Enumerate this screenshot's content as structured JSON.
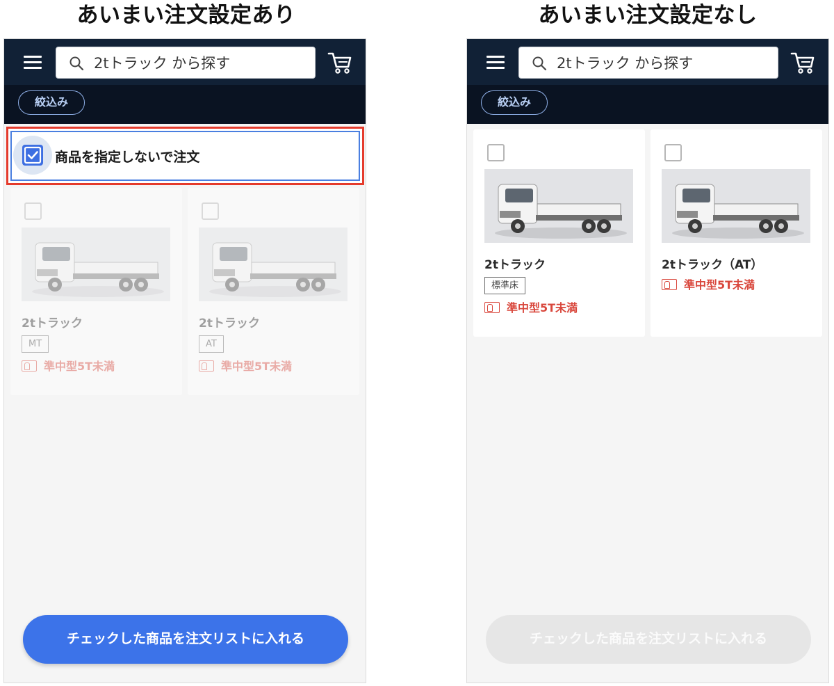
{
  "titles": {
    "left": "あいまい注文設定あり",
    "right": "あいまい注文設定なし"
  },
  "left_screen": {
    "search_text": "2tトラック から探す",
    "filter_label": "絞込み",
    "ambiguous_label": "商品を指定しないで注文",
    "ambiguous_checked": true,
    "products": [
      {
        "name": "2tトラック",
        "tag": "MT",
        "license": "準中型5T未満",
        "checked": false
      },
      {
        "name": "2tトラック",
        "tag": "AT",
        "license": "準中型5T未満",
        "checked": false
      }
    ],
    "cta_label": "チェックした商品を注文リストに入れる",
    "cta_enabled": true
  },
  "right_screen": {
    "search_text": "2tトラック から探す",
    "filter_label": "絞込み",
    "products": [
      {
        "name": "2tトラック",
        "tag": "標準床",
        "license": "準中型5T未満",
        "checked": false
      },
      {
        "name": "2tトラック（AT）",
        "license": "準中型5T未満",
        "checked": false
      }
    ],
    "cta_label": "チェックした商品を注文リストに入れる",
    "cta_enabled": false
  },
  "icons": {
    "menu": "hamburger-icon",
    "search": "search-icon",
    "cart": "cart-icon",
    "checkbox": "checkbox-icon",
    "license": "license-card-icon"
  },
  "colors": {
    "header_bg": "#112136",
    "filter_bar_bg": "#0a1322",
    "accent_blue": "#3c73e9",
    "highlight_red": "#e53b2c",
    "license_red": "#d9473c",
    "disabled_button": "#e6e6e6"
  }
}
